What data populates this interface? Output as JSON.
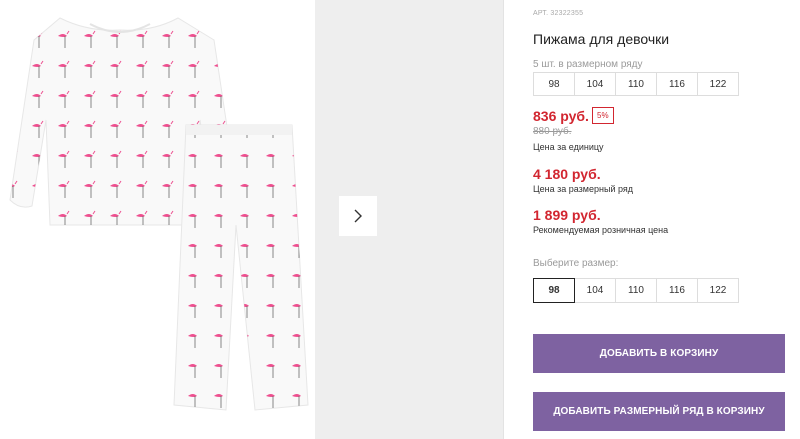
{
  "product": {
    "sku": "АРТ. 32322355",
    "title": "Пижама для девочки"
  },
  "pack": {
    "label": "5 шт. в размерном ряду",
    "sizes": [
      "98",
      "104",
      "110",
      "116",
      "122"
    ]
  },
  "prices": {
    "unit_price": "836 руб.",
    "discount": "5%",
    "old_price": "880 руб.",
    "unit_caption": "Цена за единицу",
    "pack_price": "4 180 руб.",
    "pack_caption": "Цена за размерный ряд",
    "retail_price": "1 899 руб.",
    "retail_caption": "Рекомендуемая розничная цена"
  },
  "size_picker": {
    "label": "Выберите размер:",
    "sizes": [
      "98",
      "104",
      "110",
      "116",
      "122"
    ],
    "selected": "98"
  },
  "actions": {
    "add_to_cart": "Добавить в корзину",
    "add_pack_to_cart": "Добавить размерный ряд в корзину"
  },
  "colors": {
    "accent": "#d22630",
    "button": "#7e62a1"
  },
  "icons": {
    "gallery_next": "chevron-right-icon"
  }
}
